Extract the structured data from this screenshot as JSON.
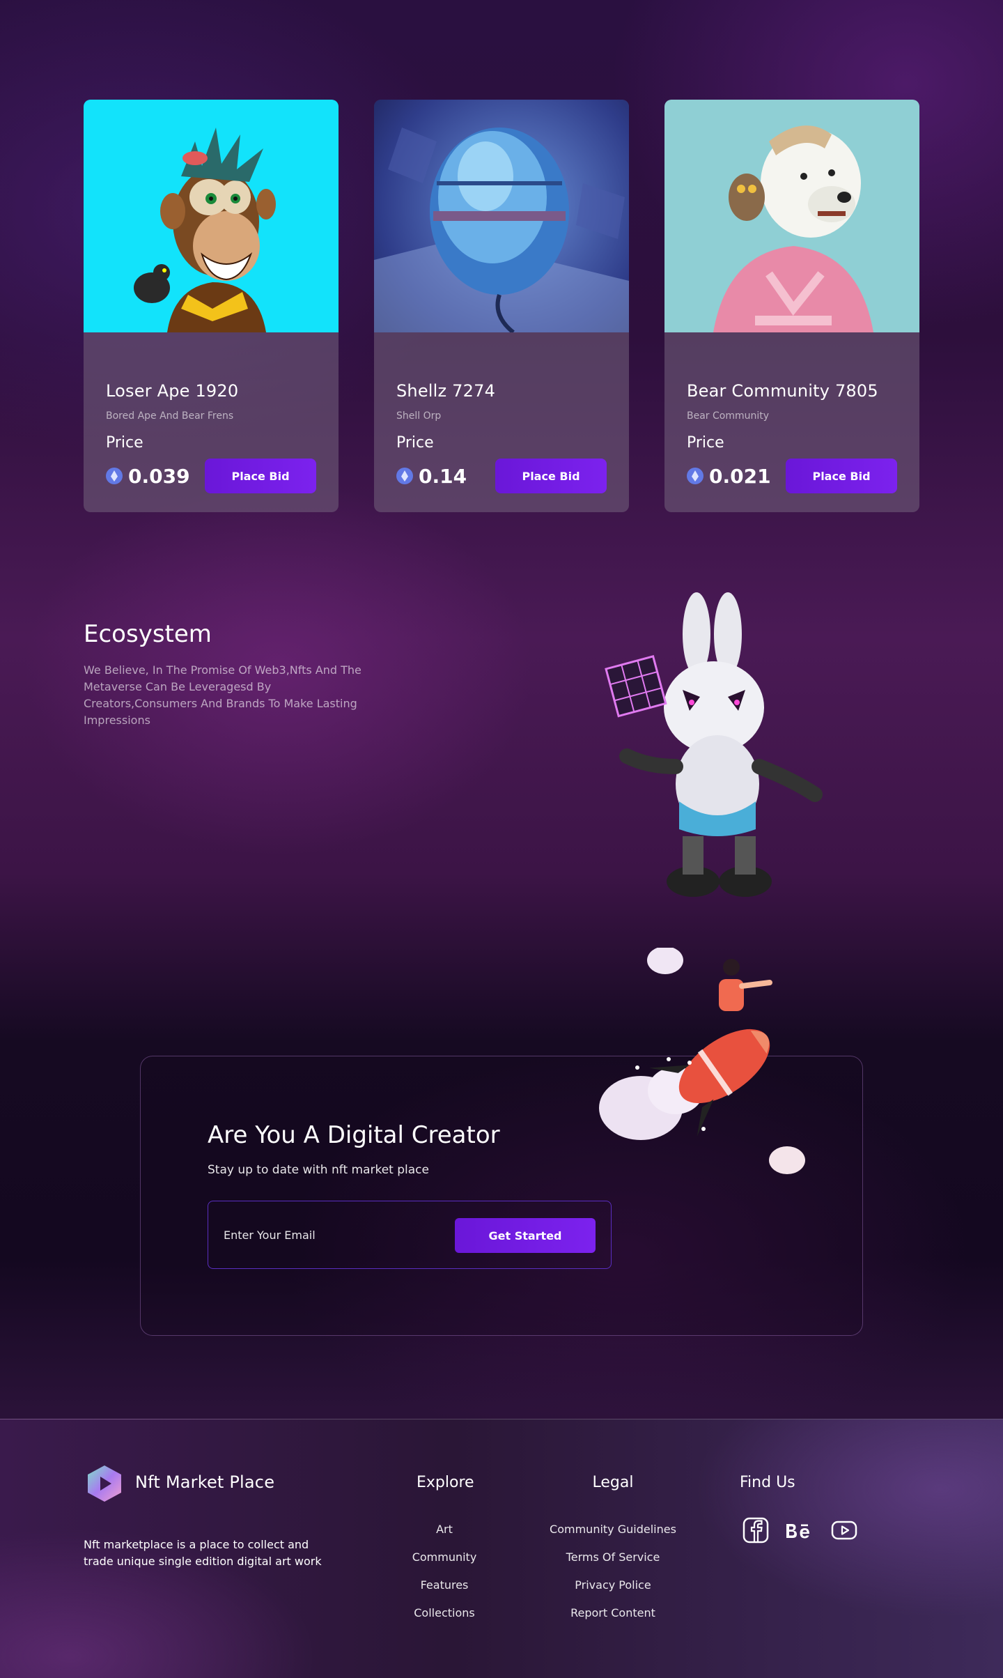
{
  "cards": [
    {
      "name": "Loser Ape 1920",
      "collection": "Bored Ape And Bear Frens",
      "price_label": "Price",
      "price": "0.039",
      "bid_label": "Place Bid"
    },
    {
      "name": "Shellz 7274",
      "collection": "Shell Orp",
      "price_label": "Price",
      "price": "0.14",
      "bid_label": "Place Bid"
    },
    {
      "name": "Bear Community 7805",
      "collection": "Bear Community",
      "price_label": "Price",
      "price": "0.021",
      "bid_label": "Place Bid"
    }
  ],
  "ecosystem": {
    "title": "Ecosystem",
    "text": "We Believe, In The Promise Of Web3,Nfts And The Metaverse Can Be Leveragesd By Creators,Consumers And Brands To Make Lasting Impressions"
  },
  "newsletter": {
    "title": "Are You A Digital Creator",
    "subtitle": "Stay up to date with nft market place",
    "email_placeholder": "Enter Your Email",
    "button_label": "Get Started"
  },
  "footer": {
    "brand": "Nft Market Place",
    "description": "Nft marketplace is a place  to collect and trade unique single edition digital art work",
    "explore": {
      "title": "Explore",
      "links": [
        "Art",
        "Community",
        "Features",
        "Collections"
      ]
    },
    "legal": {
      "title": "Legal",
      "links": [
        "Community Guidelines",
        "Terms Of Service",
        "Privacy Police",
        "Report Content"
      ]
    },
    "social": {
      "title": "Find Us",
      "icons": [
        "facebook-icon",
        "behance-icon",
        "youtube-icon"
      ]
    }
  },
  "colors": {
    "accent": "#7c22ee",
    "eth": "#6279e6"
  }
}
